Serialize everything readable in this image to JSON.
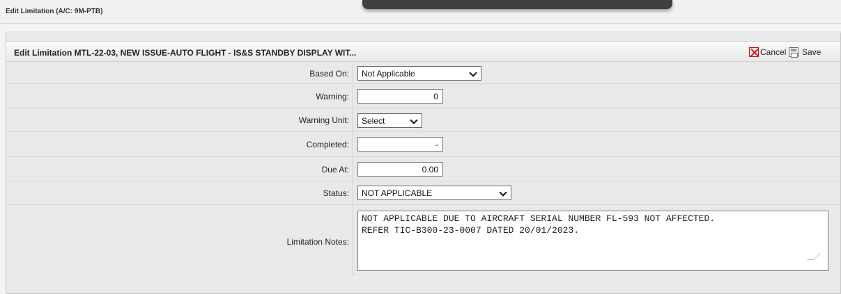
{
  "window": {
    "title": "Edit Limitation (A/C: 9M-PTB)"
  },
  "panel": {
    "title": "Edit Limitation MTL-22-03, NEW ISSUE-AUTO FLIGHT - IS&S STANDBY DISPLAY WIT...",
    "cancel_label": "Cancel",
    "save_label": "Save"
  },
  "form": {
    "based_on": {
      "label": "Based On:",
      "value": "Not Applicable"
    },
    "warning": {
      "label": "Warning:",
      "value": "0"
    },
    "warning_unit": {
      "label": "Warning Unit:",
      "value": "Select"
    },
    "completed": {
      "label": "Completed:",
      "value": "-"
    },
    "due_at": {
      "label": "Due At:",
      "value": "0.00"
    },
    "status": {
      "label": "Status:",
      "value": "NOT APPLICABLE"
    },
    "limitation_notes": {
      "label": "Limitation Notes:",
      "value": "NOT APPLICABLE DUE TO AIRCRAFT SERIAL NUMBER FL-593 NOT AFFECTED.\nREFER TIC-B300-23-0007 DATED 20/01/2023."
    }
  },
  "icons": {
    "cancel": "close-icon",
    "save": "floppy-disk-icon",
    "dropdown": "chevron-down-icon",
    "resize": "resize-handle-icon"
  },
  "colors": {
    "cancel_icon": "#dd0000",
    "panel_background": "#e9e9e9",
    "window_background": "#f3f3f3"
  }
}
